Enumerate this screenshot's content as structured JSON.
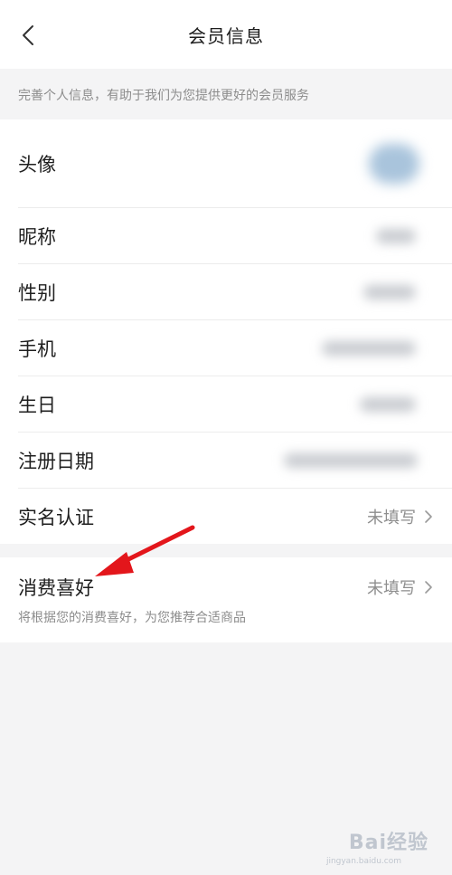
{
  "header": {
    "title": "会员信息",
    "back_icon": "chevron-left-icon"
  },
  "hint": "完善个人信息，有助于我们为您提供更好的会员服务",
  "rows": [
    {
      "label": "头像"
    },
    {
      "label": "昵称"
    },
    {
      "label": "性别"
    },
    {
      "label": "手机"
    },
    {
      "label": "生日"
    },
    {
      "label": "注册日期"
    },
    {
      "label": "实名认证",
      "value": "未填写"
    }
  ],
  "preference": {
    "label": "消费喜好",
    "value": "未填写",
    "description": "将根据您的消费喜好，为您推荐合适商品"
  },
  "watermark": {
    "text": "Bai经验",
    "sub": "jingyan.baidu.com"
  },
  "colors": {
    "annotation_arrow": "#e3161b",
    "muted_text": "#8c8c8c"
  }
}
